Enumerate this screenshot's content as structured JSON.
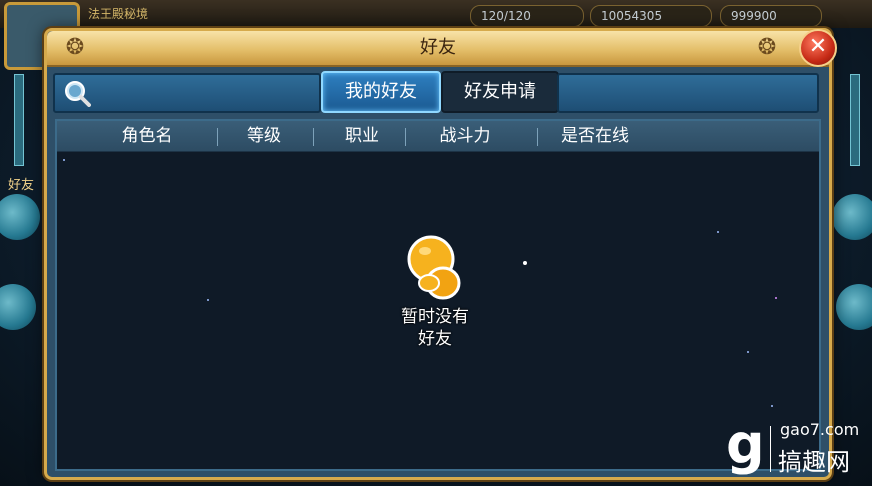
{
  "background": {
    "top_left_label": "法王殿秘境",
    "resources": [
      "120/120",
      "10054305",
      "999900"
    ],
    "left_side_label": "好友"
  },
  "dialog": {
    "title": "好友",
    "close_icon": "close-icon",
    "search": {
      "icon": "search-icon",
      "value": ""
    },
    "tabs": [
      {
        "label": "我的好友",
        "active": true
      },
      {
        "label": "好友申请",
        "active": false
      }
    ],
    "columns": [
      "角色名",
      "等级",
      "职业",
      "战斗力",
      "是否在线"
    ],
    "empty_state": {
      "line1": "暂时没有",
      "line2": "好友",
      "icon": "mascot-icon"
    }
  },
  "watermark": {
    "logo": "g",
    "url": "gao7.com",
    "name": "搞趣网"
  },
  "colors": {
    "title_gold": "#e4bf6a",
    "panel_bg": "#0f1a27",
    "tab_active": "#2e7fc0",
    "close_red": "#c62a16"
  }
}
